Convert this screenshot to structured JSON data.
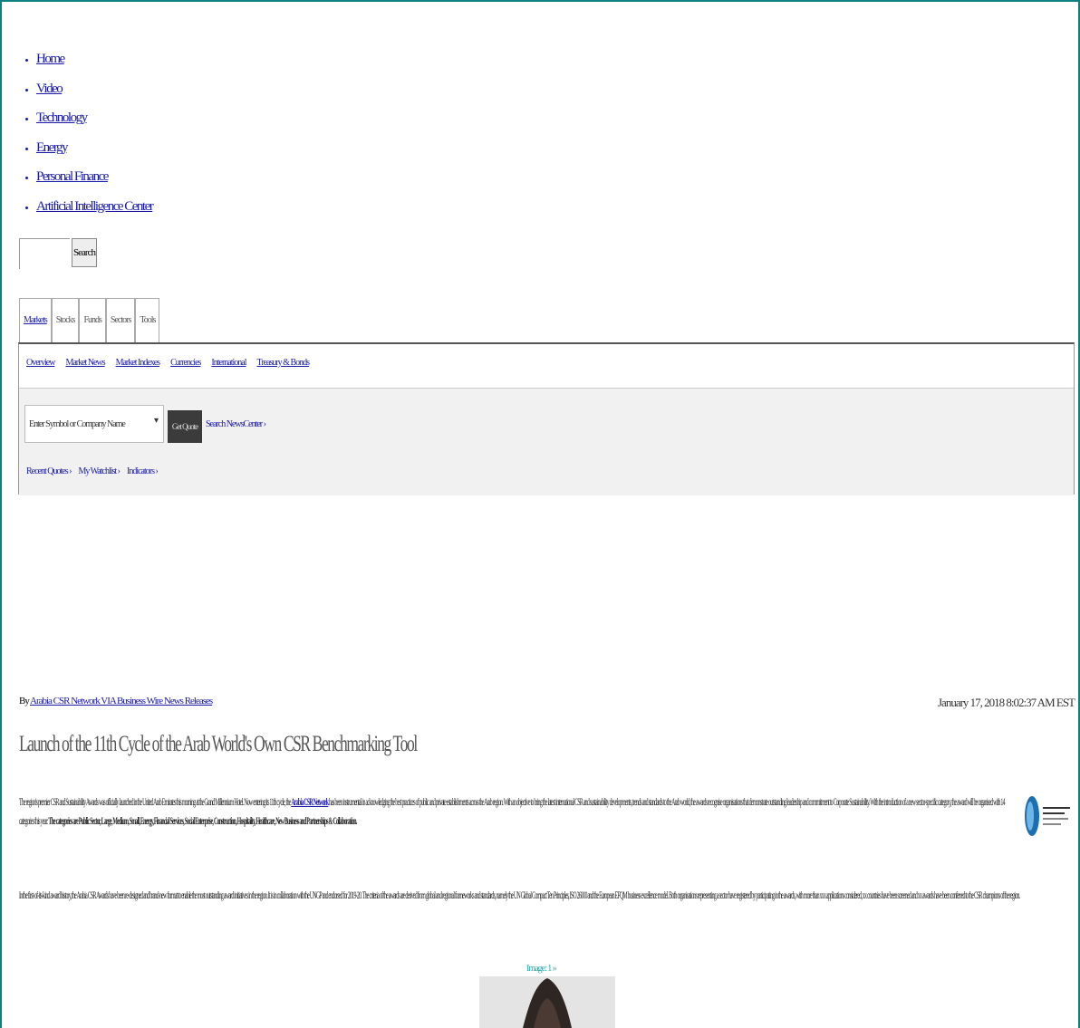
{
  "nav": {
    "items": [
      {
        "label": "Home"
      },
      {
        "label": "Video"
      },
      {
        "label": "Technology"
      },
      {
        "label": "Energy"
      },
      {
        "label": "Personal Finance"
      },
      {
        "label": "Artificial Intelligence Center"
      }
    ]
  },
  "search": {
    "button_label": "Search",
    "value": ""
  },
  "markets": {
    "tabs": [
      "Markets",
      "Stocks",
      "Funds",
      "Sectors",
      "Tools"
    ],
    "active_tab": "Markets",
    "subnav": [
      "Overview",
      "Market News",
      "Market Indexes",
      "Currencies",
      "International",
      "Treasury & Bonds"
    ],
    "quote_placeholder": "Enter Symbol or Company Name",
    "quote_button": "Get Quote",
    "search_link": "Search NewsCenter ›",
    "links": [
      "Recent Quotes ›",
      "My Watchlist ›",
      "Indicators ›"
    ]
  },
  "article": {
    "byline_prefix": "By",
    "byline_source": "Arabia CSR Network VIA Business Wire News Releases",
    "date": "January 17, 2018 8:02:37 AM EST",
    "headline": "Launch of the 11th Cycle of the Arab World's Own CSR Benchmarking Tool",
    "paragraph1_a": "The region's premier CSR and Sustainability Awards was officially launched in the United Arab Emirates this morning at the Grand Millennium Hotel. Now entering its 11th cycle, the ",
    "paragraph1_link": "Arabia CSR Network",
    "paragraph1_b": " has been instrumental in acknowledging the best practices of public and private establishments across the Arab region. With an objective to bring the latest international CSR and sustainability developments, trends and standards to the Arab world, the awards recognise organisations that demonstrate outstanding leadership and commitment to Corporate Sustainability. With the introduction of a new sector-specific category, the award will be organised with 14 categories this year: ",
    "paragraph1_bold": "The categories are Public Sector, Large, Medium, Small, Energy, Financial Services, Social Enterprise, Construction, Hospitality, Healthcare, New Business and Partnerships & Collaboration.",
    "paragraph2": "In the first-of-its-kind award history, the Arabia CSR Awards have been re-designed and brand-new format to enable the most outstanding award initiatives in the region. It is in collaboration with the UNGP and endorsed for 2019-20. The criteria of the awards are derived from global and regional frameworks and standards, namely the UN Global Compact Ten Principles, ISO 26000 and the European EFQM business excellence model. Both organisations representing a sector have registered by participating in the awards, with more than xxx applications considered, xx countries have been screened and xx awards have been conferred to the CSR champions of the region.",
    "photo_caption": "Image: 1 »"
  },
  "colors": {
    "frame": "#0d8080",
    "link": "#1a1aa6",
    "quote_button": "#3b3b3b"
  }
}
